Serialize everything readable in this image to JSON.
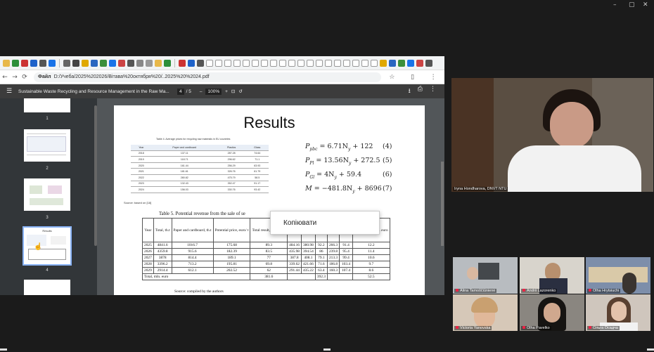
{
  "window": {
    "minimize": "–",
    "restore": "▢",
    "close": "✕"
  },
  "browser": {
    "address": {
      "prefix": "Файл",
      "url": "D:/Учеба/2025%202026/Вітава%20октября%20/..2025%20%2024.pdf"
    },
    "nav": {
      "back": "←",
      "forward": "→",
      "reload": "⟳"
    }
  },
  "pdf_toolbar": {
    "menu_icon": "☰",
    "file_name": "Sustainable Waste Recycling and Resource Management in the Raw Ma...",
    "current_page": "4",
    "total_pages": "/ 5",
    "zoom_out": "–",
    "zoom": "100%",
    "zoom_in": "+",
    "download_icon": "⭳",
    "print_icon": "⎙",
    "more_icon": "⋮"
  },
  "thumbnails": [
    {
      "label": "1"
    },
    {
      "label": "2"
    },
    {
      "label": "3"
    },
    {
      "label": "4",
      "title": "Results"
    }
  ],
  "page": {
    "title": "Results",
    "table4": {
      "caption": "Table 4. Average prices for recycling raw materials in EU countries",
      "headers": [
        "Year",
        "Paper and cardboard",
        "Plastics",
        "Glass"
      ],
      "rows": [
        [
          "2018",
          "137.11",
          "287.28",
          "74.64"
        ],
        [
          "2019",
          "118.71",
          "296.62",
          "71.1"
        ],
        [
          "2020",
          "161.44",
          "256.29",
          "63.93"
        ],
        [
          "2021",
          "181.61",
          "326.76",
          "61.79"
        ],
        [
          "2022",
          "280.82",
          "475.79",
          "58.5"
        ],
        [
          "2023",
          "132.43",
          "352.47",
          "91.17"
        ],
        [
          "2024",
          "156.03",
          "330.76",
          "93.42"
        ]
      ],
      "source": "Source: based on [18]"
    },
    "equations": [
      {
        "lhs": "P_pbc",
        "expr": "P",
        "sub": "pbc",
        "rhs": "= 6.71N",
        "rsub": "y",
        "tail": " + 122",
        "num": "(4)"
      },
      {
        "expr": "P",
        "sub": "Pl",
        "rhs": "= 13.56N",
        "rsub": "y",
        "tail": " + 272.5",
        "num": "(5)"
      },
      {
        "expr": "P",
        "sub": "Gl",
        "rhs": "= 4N",
        "rsub": "y",
        "tail": " + 59.4",
        "num": "(6)"
      },
      {
        "expr": "M",
        "sub": "",
        "rhs": "= −481.8N",
        "rsub": "y",
        "tail": " + 8696",
        "num": "(7)"
      }
    ],
    "table5": {
      "caption": "Table 5. Potential revenue from the sale of se",
      "headers": [
        "Year",
        "Total, th.t",
        "Paper and cardboard, th.t",
        "Potential price, euro/ t",
        "Total result, mln. euro",
        "",
        "euro/ t",
        "euro",
        "",
        "euro/ t",
        "Total result, mln. euro"
      ],
      "rows": [
        [
          "2025",
          "4841.6",
          "1016.7",
          "175.68",
          "89.3",
          "484.16",
          "380.98",
          "92.2",
          "266.3",
          "91.4",
          "12.2"
        ],
        [
          "2026",
          "4359.8",
          "915.6",
          "182.39",
          "83.5",
          "435.98",
          "394.54",
          "86",
          "239.8",
          "95.4",
          "11.4"
        ],
        [
          "2027",
          "3878",
          "814.4",
          "189.1",
          "77",
          "387.8",
          "408.1",
          "79.1",
          "213.3",
          "99.4",
          "10.6"
        ],
        [
          "2028",
          "3396.2",
          "713.2",
          "195.81",
          "69.8",
          "339.62",
          "421.66",
          "71.6",
          "186.8",
          "103.4",
          "9.7"
        ],
        [
          "2029",
          "2914.4",
          "612.1",
          "202.52",
          "62",
          "291.44",
          "435.22",
          "63.4",
          "160.3",
          "107.4",
          "8.6"
        ]
      ],
      "total_label": "Total, mln. euro",
      "total_a": "381.6",
      "total_b": "392.3",
      "total_c": "52.5",
      "source": "Source: compiled by the authors"
    }
  },
  "context_menu": {
    "copy": "Копіювати"
  },
  "participants": {
    "main": "Iryna Hondharova, DNVT NTU",
    "tiles": [
      "Alina Tamoščiūnienė",
      "Andrii Lazorenko",
      "Olha Hrytsiuchi",
      "Victoria Yanovska",
      "Olha Pavelko",
      "Ольга Осадча"
    ]
  }
}
